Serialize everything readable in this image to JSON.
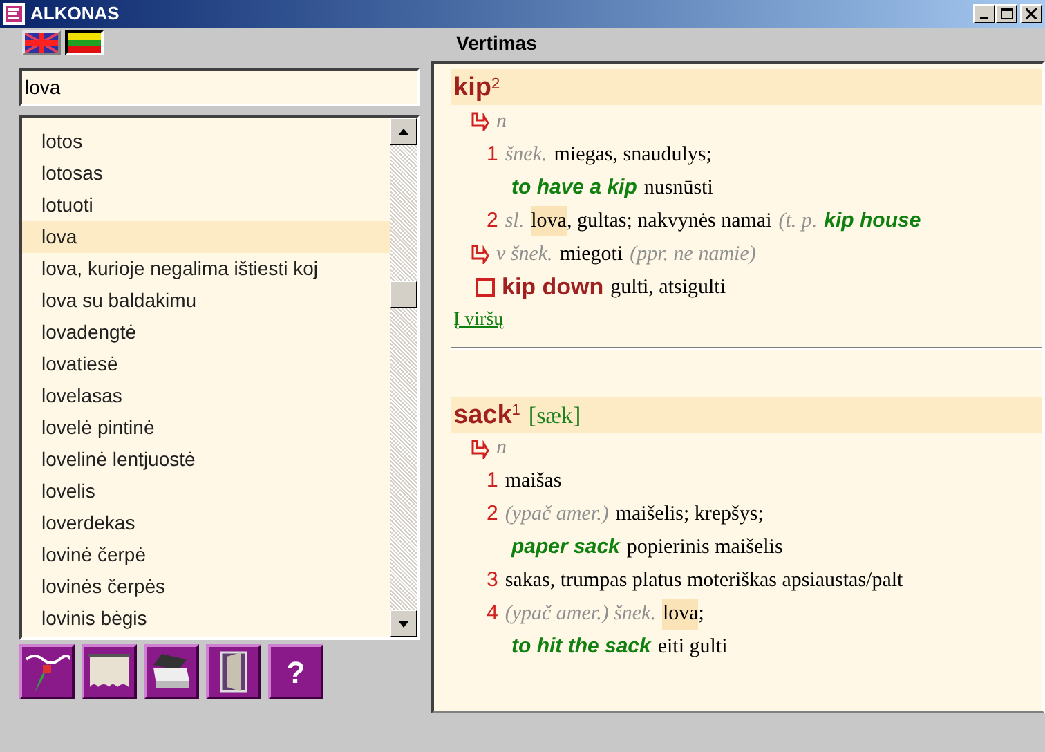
{
  "window": {
    "title": "ALKONAS"
  },
  "languages": [
    {
      "kind": "en",
      "selected": false
    },
    {
      "kind": "lt",
      "selected": true
    }
  ],
  "panel_title": "Vertimas",
  "search": {
    "value": "lova"
  },
  "word_list": [
    {
      "text": "lotos",
      "selected": false
    },
    {
      "text": "lotosas",
      "selected": false
    },
    {
      "text": "lotuoti",
      "selected": false
    },
    {
      "text": "lova",
      "selected": true
    },
    {
      "text": "lova, kurioje negalima ištiesti koj",
      "selected": false
    },
    {
      "text": "lova su baldakimu",
      "selected": false
    },
    {
      "text": "lovadengtė",
      "selected": false
    },
    {
      "text": "lovatiesė",
      "selected": false
    },
    {
      "text": "lovelasas",
      "selected": false
    },
    {
      "text": "lovelė pintinė",
      "selected": false
    },
    {
      "text": "lovelinė lentjuostė",
      "selected": false
    },
    {
      "text": "lovelis",
      "selected": false
    },
    {
      "text": "loverdekas",
      "selected": false
    },
    {
      "text": "lovinė čerpė",
      "selected": false
    },
    {
      "text": "lovinės čerpės",
      "selected": false
    },
    {
      "text": "lovinis bėgis",
      "selected": false
    }
  ],
  "toolbar": [
    {
      "kind": "wave"
    },
    {
      "kind": "curtain"
    },
    {
      "kind": "printer"
    },
    {
      "kind": "door"
    },
    {
      "kind": "help",
      "text": "?"
    }
  ],
  "entries": [
    {
      "headword": "kip",
      "sup": "2",
      "lines": [
        {
          "kind": "pos",
          "parts": [
            {
              "kind": "label",
              "text": "n"
            }
          ]
        },
        {
          "kind": "sense",
          "parts": [
            {
              "kind": "num",
              "text": "1"
            },
            {
              "kind": "label",
              "text": "šnek."
            },
            {
              "kind": "text",
              "text": "miegas, snaudulys;"
            }
          ]
        },
        {
          "kind": "example",
          "parts": [
            {
              "kind": "phrase",
              "text": "to have a kip"
            },
            {
              "kind": "text",
              "text": "nusnūsti"
            }
          ]
        },
        {
          "kind": "sense",
          "parts": [
            {
              "kind": "num",
              "text": "2"
            },
            {
              "kind": "label",
              "text": "sl."
            },
            {
              "kind": "hl",
              "text": "lova"
            },
            {
              "kind": "text",
              "text": ", gultas; nakvynės namai"
            },
            {
              "kind": "label",
              "text": "(t. p."
            },
            {
              "kind": "phrase",
              "text": "kip house"
            }
          ]
        },
        {
          "kind": "pos",
          "parts": [
            {
              "kind": "label",
              "text": "v šnek."
            },
            {
              "kind": "text",
              "text": "miegoti"
            },
            {
              "kind": "label",
              "text": "(ppr. ne namie)"
            }
          ]
        },
        {
          "kind": "idiom",
          "parts": [
            {
              "kind": "idiom",
              "text": "kip down"
            },
            {
              "kind": "text",
              "text": "gulti, atsigulti"
            }
          ]
        }
      ],
      "top_link": "Į viršų"
    },
    {
      "headword": "sack",
      "sup": "1",
      "pron": "[sæk]",
      "lines": [
        {
          "kind": "pos",
          "parts": [
            {
              "kind": "label",
              "text": "n"
            }
          ]
        },
        {
          "kind": "sense",
          "parts": [
            {
              "kind": "num",
              "text": "1"
            },
            {
              "kind": "text",
              "text": "maišas"
            }
          ]
        },
        {
          "kind": "sense",
          "parts": [
            {
              "kind": "num",
              "text": "2"
            },
            {
              "kind": "label",
              "text": "(ypač amer.)"
            },
            {
              "kind": "text",
              "text": "maišelis; krepšys;"
            }
          ]
        },
        {
          "kind": "example",
          "parts": [
            {
              "kind": "phrase",
              "text": "paper sack"
            },
            {
              "kind": "text",
              "text": "popierinis maišelis"
            }
          ]
        },
        {
          "kind": "sense",
          "parts": [
            {
              "kind": "num",
              "text": "3"
            },
            {
              "kind": "text",
              "text": "sakas, trumpas platus moteriškas apsiaustas/palt"
            }
          ]
        },
        {
          "kind": "sense",
          "parts": [
            {
              "kind": "num",
              "text": "4"
            },
            {
              "kind": "label",
              "text": "(ypač amer.) šnek."
            },
            {
              "kind": "hl",
              "text": "lova"
            },
            {
              "kind": "text",
              "text": ";"
            }
          ]
        },
        {
          "kind": "example",
          "parts": [
            {
              "kind": "phrase",
              "text": "to hit the sack"
            },
            {
              "kind": "text",
              "text": "eiti gulti"
            }
          ]
        }
      ]
    }
  ]
}
